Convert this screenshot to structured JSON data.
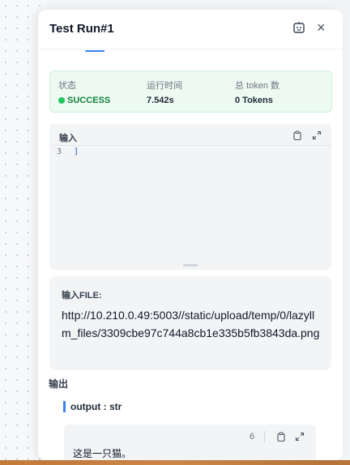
{
  "header": {
    "title": "Test Run#1",
    "robot_icon": "robot-icon",
    "close_label": "×"
  },
  "status": {
    "state_label": "状态",
    "state_value": "SUCCESS",
    "time_label": "运行时间",
    "time_value": "7.542s",
    "token_label": "总 token 数",
    "token_value": "0 Tokens",
    "success_color": "#22c55e"
  },
  "input": {
    "label": "输入",
    "line_number": "3",
    "line_content": "]"
  },
  "file": {
    "label": "输入FILE:",
    "url": "http://10.210.0.49:5003//static/upload/temp/0/lazyllm_files/3309cbe97c744a8cb1e335b5fb3843da.png"
  },
  "output": {
    "label": "输出",
    "type": "output : str",
    "count": "6",
    "text": "这是一只猫。"
  }
}
